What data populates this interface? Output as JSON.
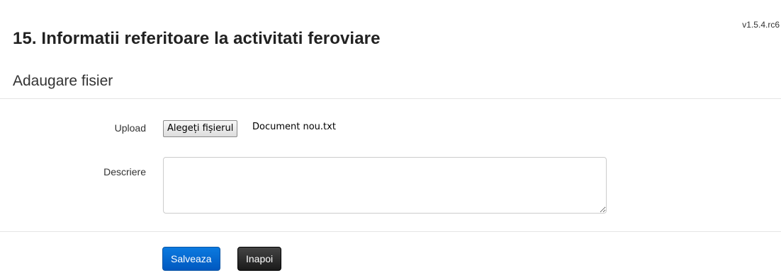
{
  "header": {
    "version": "v1.5.4.rc6",
    "title": "15. Informatii referitoare la activitati feroviare"
  },
  "section": {
    "title": "Adaugare fisier"
  },
  "form": {
    "upload": {
      "label": "Upload",
      "button_label": "Alegeți fișierul",
      "file_name": "Document nou.txt"
    },
    "description": {
      "label": "Descriere",
      "value": ""
    }
  },
  "actions": {
    "save_label": "Salveaza",
    "back_label": "Inapoi"
  },
  "colors": {
    "save_button": "#0068d6",
    "back_button": "#2b2b2b",
    "divider": "#e5e5e5"
  }
}
